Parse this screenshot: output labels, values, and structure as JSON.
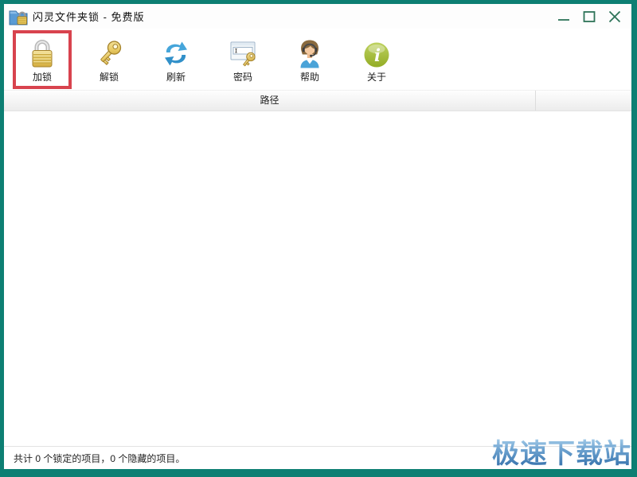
{
  "window": {
    "title": "闪灵文件夹锁 - 免费版",
    "border_color": "#0d7f73",
    "edition": "免费版"
  },
  "titlebar": {
    "app_icon": "folder-lock-icon",
    "controls": [
      {
        "name": "minimize"
      },
      {
        "name": "maximize"
      },
      {
        "name": "close"
      }
    ]
  },
  "toolbar": {
    "highlight_color": "#d8434e",
    "buttons": [
      {
        "label": "加锁",
        "icon": "lock-icon",
        "highlighted": true
      },
      {
        "label": "解锁",
        "icon": "key-icon",
        "highlighted": false
      },
      {
        "label": "刷新",
        "icon": "refresh-icon",
        "highlighted": false
      },
      {
        "label": "密码",
        "icon": "password-icon",
        "highlighted": false
      },
      {
        "label": "帮助",
        "icon": "help-icon",
        "highlighted": false
      },
      {
        "label": "关于",
        "icon": "about-icon",
        "highlighted": false
      }
    ]
  },
  "list": {
    "columns": [
      {
        "label": "路径"
      },
      {
        "label": ""
      }
    ],
    "rows": []
  },
  "statusbar": {
    "text": "共计 0 个锁定的项目，0 个隐藏的项目。",
    "locked_count": 0,
    "hidden_count": 0
  },
  "watermark": {
    "text": "极速下载站",
    "color": "#4e8ec5"
  }
}
